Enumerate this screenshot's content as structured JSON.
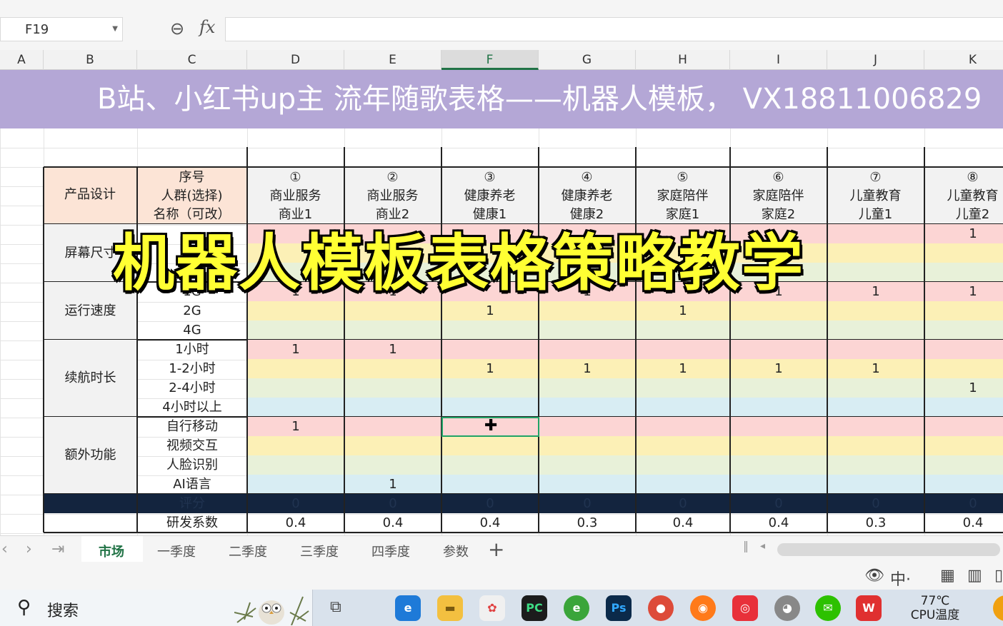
{
  "formula_bar": {
    "cell_ref": "F19",
    "fx_label": "fx",
    "value": ""
  },
  "columns": [
    "A",
    "B",
    "C",
    "D",
    "E",
    "F",
    "G",
    "H",
    "I",
    "J",
    "K"
  ],
  "active_column": "F",
  "banner": "B站、小红书up主    流年随歌表格——机器人模板，  VX18811006829",
  "header": {
    "product_design": "产品设计",
    "col_c": [
      "序号",
      "人群(选择)",
      "名称（可改）"
    ],
    "products": [
      {
        "num": "①",
        "crowd": "商业服务",
        "name": "商业1"
      },
      {
        "num": "②",
        "crowd": "商业服务",
        "name": "商业2"
      },
      {
        "num": "③",
        "crowd": "健康养老",
        "name": "健康1"
      },
      {
        "num": "④",
        "crowd": "健康养老",
        "name": "健康2"
      },
      {
        "num": "⑤",
        "crowd": "家庭陪伴",
        "name": "家庭1"
      },
      {
        "num": "⑥",
        "crowd": "家庭陪伴",
        "name": "家庭2"
      },
      {
        "num": "⑦",
        "crowd": "儿童教育",
        "name": "儿童1"
      },
      {
        "num": "⑧",
        "crowd": "儿童教育",
        "name": "儿童2"
      }
    ]
  },
  "sections": [
    {
      "title": "屏幕尺寸",
      "rows": [
        {
          "label": "",
          "values": [
            "",
            "",
            "",
            "",
            "",
            "",
            "",
            "1"
          ]
        },
        {
          "label": "",
          "values": [
            "",
            "",
            "",
            "",
            "",
            "",
            "",
            ""
          ]
        },
        {
          "label": "",
          "values": [
            "",
            "",
            "",
            "",
            "",
            "",
            "",
            ""
          ]
        }
      ]
    },
    {
      "title": "运行速度",
      "rows": [
        {
          "label": "1G",
          "values": [
            "1",
            "1",
            "",
            "1",
            "",
            "1",
            "1",
            "1"
          ]
        },
        {
          "label": "2G",
          "values": [
            "",
            "",
            "1",
            "",
            "1",
            "",
            "",
            ""
          ]
        },
        {
          "label": "4G",
          "values": [
            "",
            "",
            "",
            "",
            "",
            "",
            "",
            ""
          ]
        }
      ]
    },
    {
      "title": "续航时长",
      "rows": [
        {
          "label": "1小时",
          "values": [
            "1",
            "1",
            "",
            "",
            "",
            "",
            "",
            ""
          ]
        },
        {
          "label": "1-2小时",
          "values": [
            "",
            "",
            "1",
            "1",
            "1",
            "1",
            "1",
            ""
          ]
        },
        {
          "label": "2-4小时",
          "values": [
            "",
            "",
            "",
            "",
            "",
            "",
            "",
            "1"
          ]
        },
        {
          "label": "4小时以上",
          "values": [
            "",
            "",
            "",
            "",
            "",
            "",
            "",
            ""
          ]
        }
      ]
    },
    {
      "title": "额外功能",
      "rows": [
        {
          "label": "自行移动",
          "values": [
            "1",
            "",
            "",
            "",
            "",
            "",
            "",
            ""
          ]
        },
        {
          "label": "视频交互",
          "values": [
            "",
            "",
            "",
            "",
            "",
            "",
            "",
            ""
          ]
        },
        {
          "label": "人脸识别",
          "values": [
            "",
            "",
            "",
            "",
            "",
            "",
            "",
            ""
          ]
        },
        {
          "label": "AI语言",
          "values": [
            "",
            "1",
            "",
            "",
            "",
            "",
            "",
            ""
          ]
        }
      ]
    }
  ],
  "score_row": {
    "label": "评分",
    "values": [
      "0",
      "0",
      "0",
      "0",
      "0",
      "0",
      "0",
      "0"
    ]
  },
  "rd_row": {
    "label": "研发系数",
    "values": [
      "0.4",
      "0.4",
      "0.4",
      "0.3",
      "0.4",
      "0.4",
      "0.3",
      "0.4"
    ]
  },
  "overlay_title": "机器人模板表格策略教学",
  "sheet_tabs": [
    "市场",
    "一季度",
    "二季度",
    "三季度",
    "四季度",
    "参数"
  ],
  "active_tab": "市场",
  "taskbar": {
    "search_label": "搜索",
    "temp_value": "77℃",
    "temp_label": "CPU温度"
  },
  "colors": {
    "banner": "#b4a7d6",
    "header_peach": "#fce4d6",
    "band_pink": "#fcd5d4",
    "band_yellow": "#fcf0b6",
    "band_green": "#e8f1d9",
    "band_blue": "#d8edf3",
    "score_row": "#13243e",
    "accent": "#217346"
  }
}
